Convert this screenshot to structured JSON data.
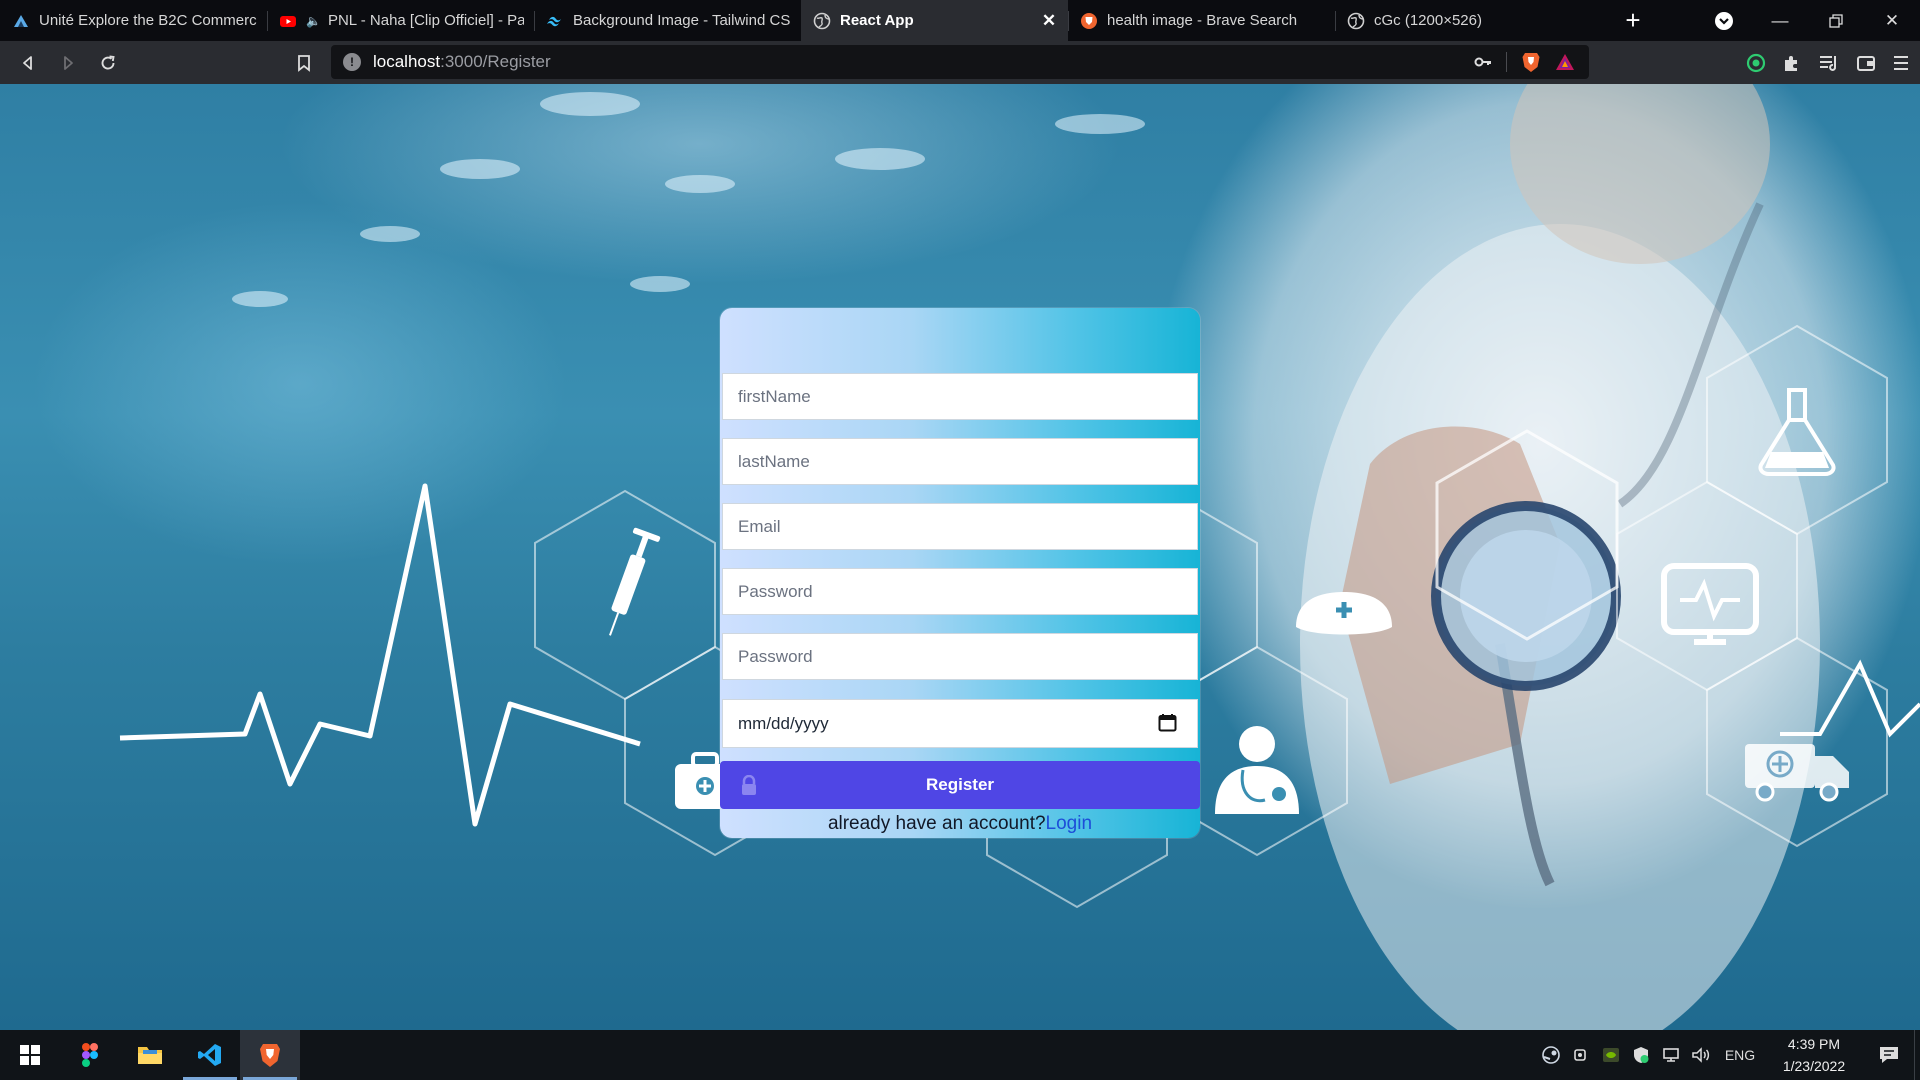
{
  "browser": {
    "tabs": [
      {
        "title": "Unité Explore the B2C Commerce",
        "icon": "trailhead-icon",
        "active": false
      },
      {
        "title": "PNL - Naha [Clip Officiel] - Pa",
        "icon": "youtube-icon",
        "active": false,
        "audio": true
      },
      {
        "title": "Background Image - Tailwind CSS",
        "icon": "tailwind-icon",
        "active": false
      },
      {
        "title": "React App",
        "icon": "globe-icon",
        "active": true
      },
      {
        "title": "health image - Brave Search",
        "icon": "brave-search-icon",
        "active": false
      },
      {
        "title": "cGc (1200×526)",
        "icon": "globe-icon",
        "active": false
      }
    ],
    "address": {
      "host": "localhost",
      "path": ":3000/Register"
    }
  },
  "form": {
    "fields": [
      {
        "placeholder": "firstName"
      },
      {
        "placeholder": "lastName"
      },
      {
        "placeholder": "Email"
      },
      {
        "placeholder": "Password"
      },
      {
        "placeholder": "Password"
      }
    ],
    "date_placeholder": "mm/dd/yyyy",
    "register_label": "Register",
    "login_prompt": "already have an account?",
    "login_link": "Login"
  },
  "taskbar": {
    "apps": [
      "windows-start",
      "figma",
      "file-explorer",
      "vscode",
      "brave"
    ],
    "language": "ENG",
    "time": "4:39 PM",
    "date": "1/23/2022"
  },
  "colors": {
    "register_button": "#4f46e5",
    "login_link": "#1d4ed8",
    "card_gradient_start": "#cfe0ff",
    "card_gradient_end": "#17b4d6"
  }
}
